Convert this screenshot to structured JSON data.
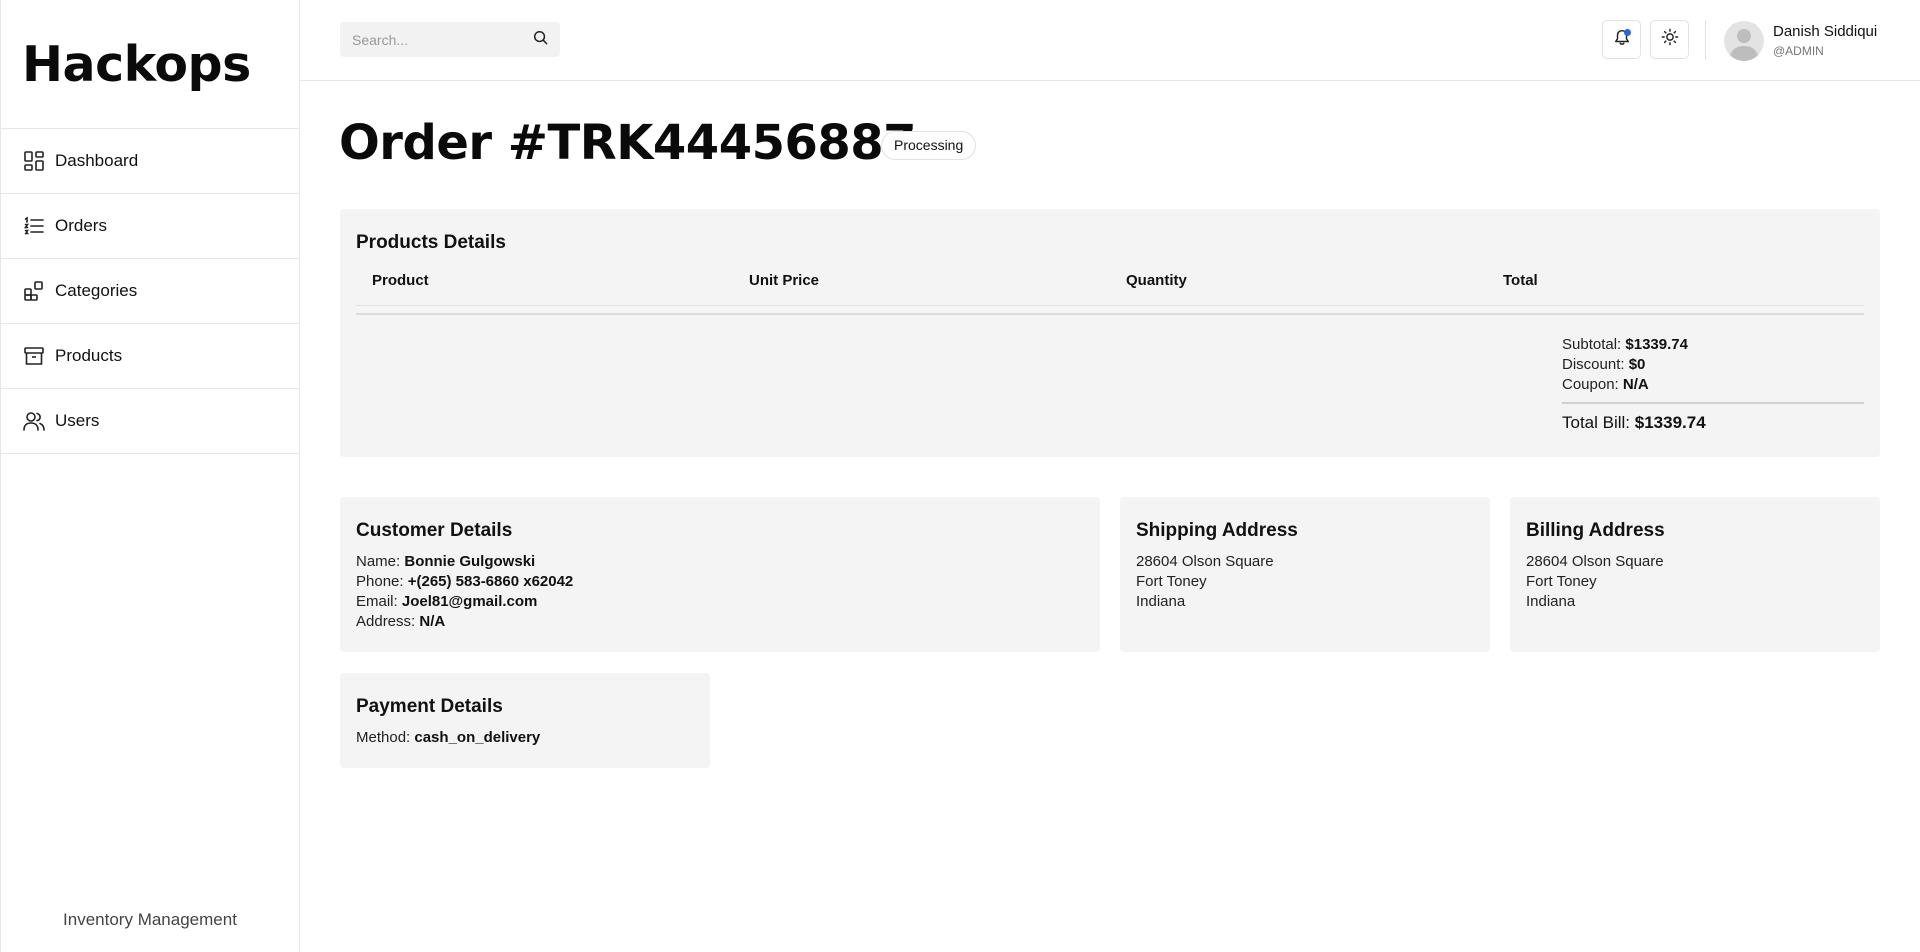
{
  "sidebar": {
    "brand": "Hackops",
    "items": [
      {
        "label": "Dashboard",
        "icon": "dashboard-icon"
      },
      {
        "label": "Orders",
        "icon": "list-icon"
      },
      {
        "label": "Categories",
        "icon": "categories-icon"
      },
      {
        "label": "Products",
        "icon": "archive-box-icon"
      },
      {
        "label": "Users",
        "icon": "users-icon"
      }
    ],
    "footer": "Inventory Management"
  },
  "header": {
    "search_placeholder": "Search...",
    "user_name": "Danish Siddiqui",
    "user_role": "@ADMIN",
    "notification_dot_color": "#2563eb"
  },
  "order": {
    "title": "Order #TRK44456887",
    "status": "Processing"
  },
  "products": {
    "heading": "Products Details",
    "columns": [
      "Product",
      "Unit Price",
      "Quantity",
      "Total"
    ],
    "rows": [],
    "subtotal_label": "Subtotal:",
    "subtotal": "$1339.74",
    "discount_label": "Discount:",
    "discount": "$0",
    "coupon_label": "Coupon:",
    "coupon": "N/A",
    "total_label": "Total Bill:",
    "total": "$1339.74"
  },
  "customer": {
    "heading": "Customer Details",
    "name_label": "Name:",
    "name": "Bonnie Gulgowski",
    "phone_label": "Phone:",
    "phone": "+(265) 583-6860 x62042",
    "email_label": "Email:",
    "email": "Joel81@gmail.com",
    "address_label": "Address:",
    "address": "N/A"
  },
  "shipping": {
    "heading": "Shipping Address",
    "line1": "28604 Olson Square",
    "line2": "Fort Toney",
    "line3": "Indiana"
  },
  "billing": {
    "heading": "Billing Address",
    "line1": "28604 Olson Square",
    "line2": "Fort Toney",
    "line3": "Indiana"
  },
  "payment": {
    "heading": "Payment Details",
    "method_label": "Method:",
    "method": "cash_on_delivery"
  }
}
